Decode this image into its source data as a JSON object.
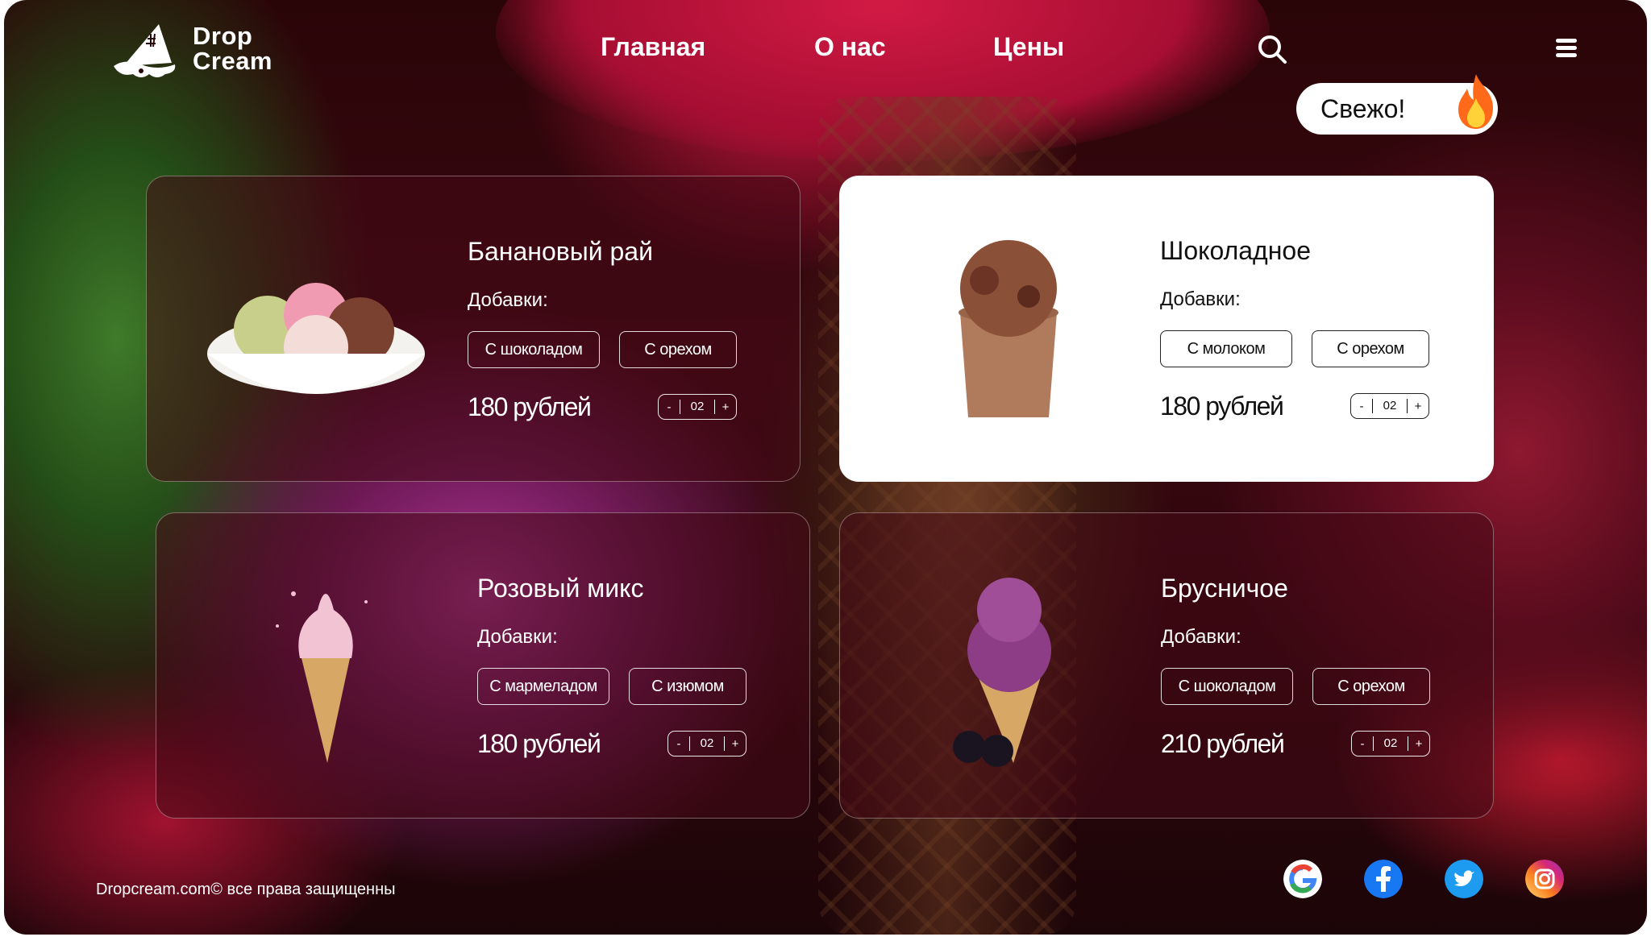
{
  "brand": {
    "line1": "Drop",
    "line2": "Cream"
  },
  "nav": {
    "home": "Главная",
    "about": "О нас",
    "prices": "Цены"
  },
  "badge": {
    "label": "Свежо!"
  },
  "addons_label": "Добавки:",
  "products": [
    {
      "title": "Банановый рай",
      "addons": [
        "С шоколадом",
        "С орехом"
      ],
      "price": "180 рублей",
      "qty": "02",
      "minus": "-",
      "plus": "+"
    },
    {
      "title": "Шоколадное",
      "addons": [
        "С молоком",
        "С орехом"
      ],
      "price": "180 рублей",
      "qty": "02",
      "minus": "-",
      "plus": "+"
    },
    {
      "title": "Розовый микс",
      "addons": [
        "С мармеладом",
        "С изюмом"
      ],
      "price": "180 рублей",
      "qty": "02",
      "minus": "-",
      "plus": "+"
    },
    {
      "title": "Брусничое",
      "addons": [
        "С шоколадом",
        "С орехом"
      ],
      "price": "210 рублей",
      "qty": "02",
      "minus": "-",
      "plus": "+"
    }
  ],
  "footer": {
    "copyright": "Dropcream.com© все права защищенны"
  },
  "social": [
    "google-icon",
    "facebook-icon",
    "twitter-icon",
    "instagram-icon"
  ],
  "colors": {
    "accent": "#c4153d",
    "card_light": "#ffffff",
    "text_light": "#ffffff",
    "text_dark": "#111111"
  }
}
